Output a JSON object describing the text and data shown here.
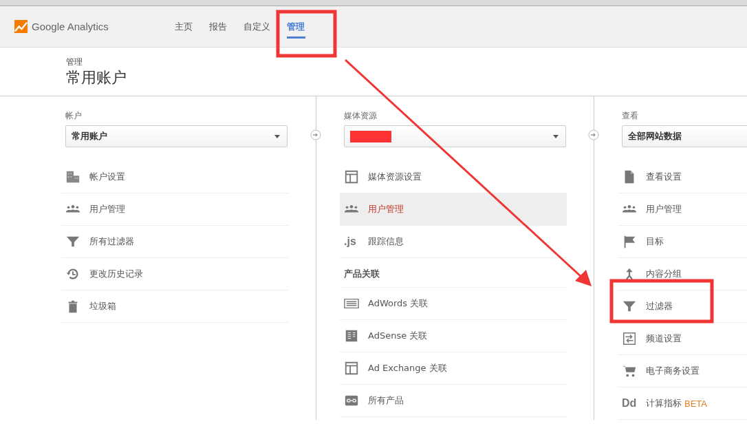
{
  "header": {
    "brand": "Google Analytics",
    "tabs": [
      {
        "label": "主页",
        "selected": false
      },
      {
        "label": "报告",
        "selected": false
      },
      {
        "label": "自定义",
        "selected": false
      },
      {
        "label": "管理",
        "selected": true
      }
    ]
  },
  "page": {
    "breadcrumb": "管理",
    "title": "常用账户"
  },
  "columns": [
    {
      "label": "帐户",
      "dropdown": "常用账户",
      "items": [
        {
          "label": "帐户设置",
          "selected": false
        },
        {
          "label": "用户管理",
          "selected": false
        },
        {
          "label": "所有过滤器",
          "selected": false
        },
        {
          "label": "更改历史记录",
          "selected": false
        },
        {
          "label": "垃圾箱",
          "selected": false
        }
      ]
    },
    {
      "label": "媒体资源",
      "redacted": true,
      "items": [
        {
          "label": "媒体资源设置",
          "selected": false
        },
        {
          "label": "用户管理",
          "selected": true
        },
        {
          "label": "跟踪信息",
          "glyph": ".js",
          "selected": false
        }
      ],
      "section": {
        "title": "产品关联",
        "items": [
          {
            "label": "AdWords 关联",
            "selected": false
          },
          {
            "label": "AdSense 关联",
            "selected": false
          },
          {
            "label": "Ad Exchange 关联",
            "selected": false
          },
          {
            "label": "所有产品",
            "selected": false
          }
        ]
      }
    },
    {
      "label": "查看",
      "dropdown": "全部网站数据",
      "items": [
        {
          "label": "查看设置",
          "selected": false
        },
        {
          "label": "用户管理",
          "selected": false
        },
        {
          "label": "目标",
          "selected": false
        },
        {
          "label": "内容分组",
          "selected": false
        },
        {
          "label": "过滤器",
          "selected": false
        },
        {
          "label": "频道设置",
          "selected": false
        },
        {
          "label": "电子商务设置",
          "selected": false
        },
        {
          "label": "计算指标",
          "glyph": "Dd",
          "badge": "BETA",
          "selected": false
        }
      ]
    }
  ]
}
